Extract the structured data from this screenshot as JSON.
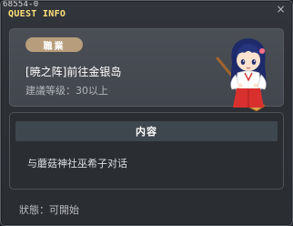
{
  "window": {
    "quest_id": "68554-0",
    "title": "QUEST INFO",
    "close_label": "×"
  },
  "quest": {
    "job_badge": "職業",
    "name": "[暁之阵]前往金银岛",
    "level_requirement": "建議等级：30以上"
  },
  "content": {
    "header": "内容",
    "text": "与蘑菇神社巫希子对话"
  },
  "status": {
    "text": "狀態：可開始"
  },
  "colors": {
    "title": "#ffe27a",
    "badge": "#b89d7c",
    "panel": "#464a51"
  },
  "icons": {
    "npc": "shrine-maiden-npc-portrait",
    "close": "close-icon"
  }
}
